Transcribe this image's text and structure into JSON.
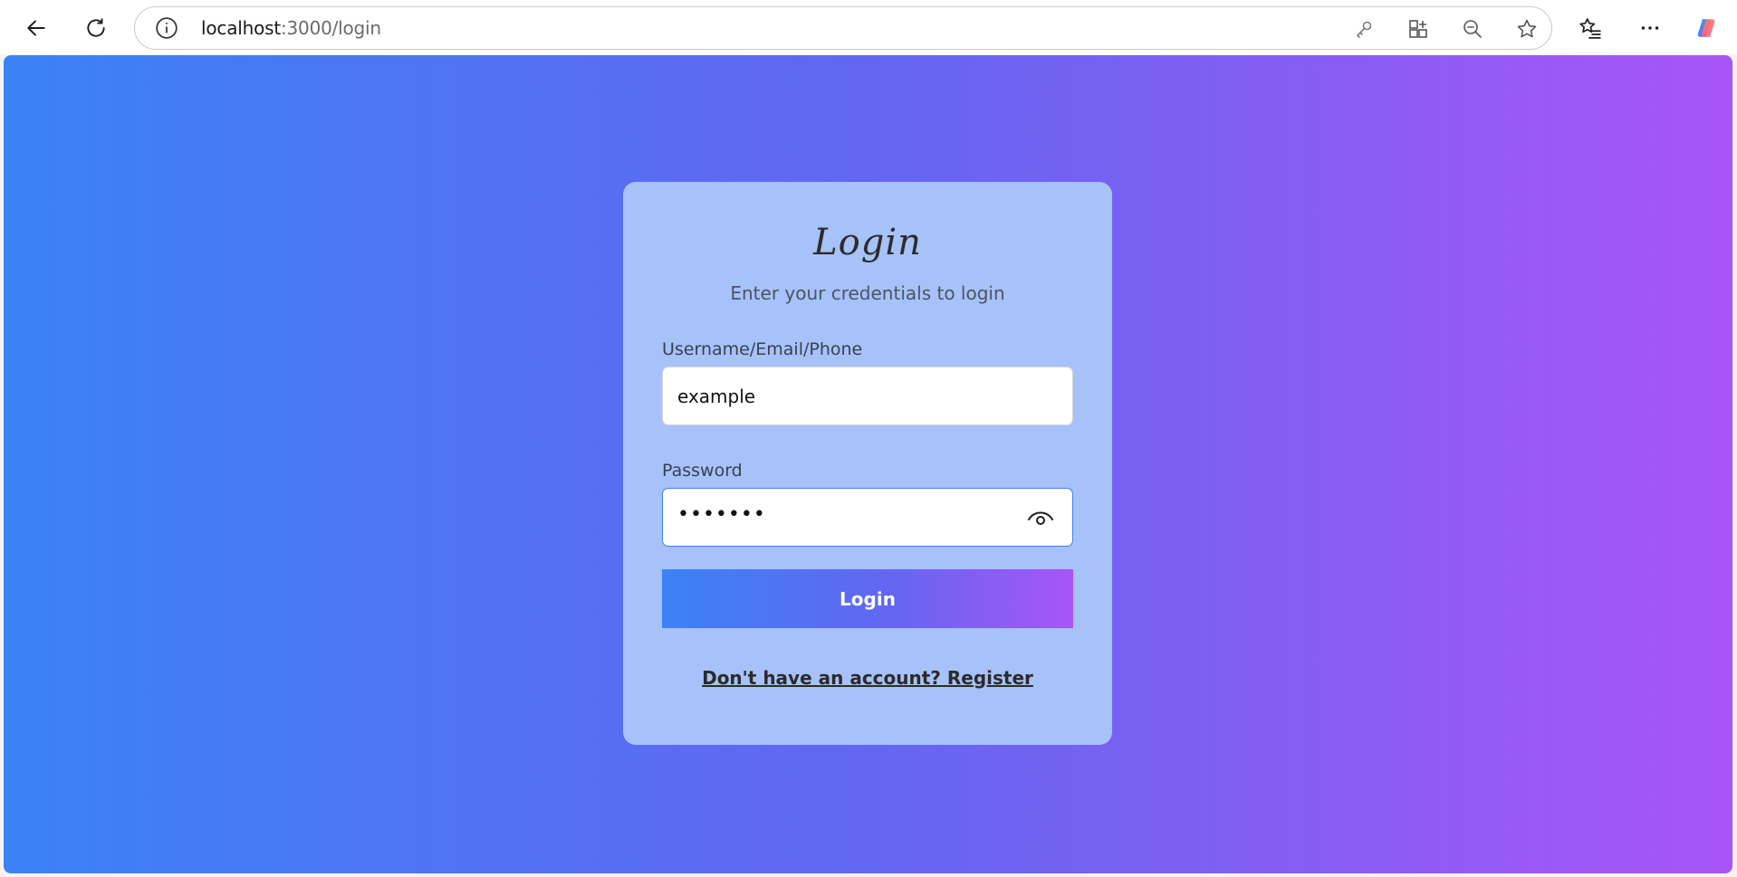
{
  "browser": {
    "url_host": "localhost",
    "url_path": ":3000/login"
  },
  "icons": {
    "back": "back-arrow-icon",
    "reload": "reload-icon",
    "info": "info-icon",
    "password_key": "key-icon",
    "apps": "apps-icon",
    "zoom_out": "zoom-out-icon",
    "favorite": "star-icon",
    "favorites_list": "favorites-icon",
    "more": "more-icon",
    "copilot": "copilot-icon",
    "show_password": "eye-icon"
  },
  "colors": {
    "gradient_start": "#3b82f6",
    "gradient_mid": "#6366f1",
    "gradient_end": "#a855f7",
    "card_bg": "#a7c2f8"
  },
  "login": {
    "title": "Login",
    "subtitle": "Enter your credentials to login",
    "username_label": "Username/Email/Phone",
    "username_value": "example",
    "password_label": "Password",
    "password_value": "•••••••",
    "submit_label": "Login",
    "register_link": "Don't have an account? Register"
  }
}
